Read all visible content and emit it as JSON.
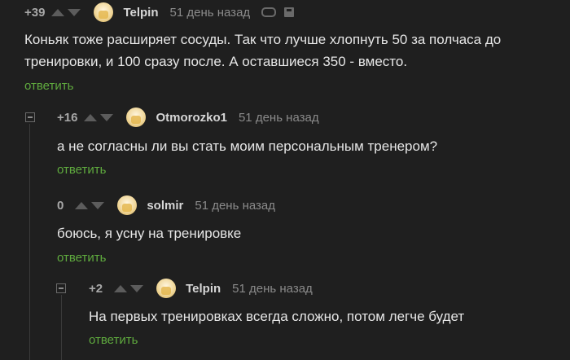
{
  "comments": [
    {
      "rating": "+39",
      "username": "Telpin",
      "time": "51 день назад",
      "text_lines": [
        "Коньяк тоже расширяет сосуды. Так что лучше хлопнуть 50 за полчаса до",
        "тренировки, и 100 сразу после. А оставшиеся 350 - вместо."
      ],
      "reply": "ответить"
    },
    {
      "rating": "+16",
      "username": "Otmorozko1",
      "time": "51 день назад",
      "text_lines": [
        "а не согласны ли вы стать моим персональным тренером?"
      ],
      "reply": "ответить"
    },
    {
      "rating": "0",
      "username": "solmir",
      "time": "51 день назад",
      "text_lines": [
        "боюсь, я усну на тренировке"
      ],
      "reply": "ответить"
    },
    {
      "rating": "+2",
      "username": "Telpin",
      "time": "51 день назад",
      "text_lines": [
        "На первых тренировках всегда сложно, потом легче будет"
      ],
      "reply": "ответить"
    }
  ],
  "icons": {
    "avatar": "avatar-icon",
    "upvote": "arrow-up-icon",
    "downvote": "arrow-down-icon",
    "link": "link-icon",
    "save": "save-icon",
    "collapse": "collapse-icon"
  },
  "colors": {
    "background": "#1f1f1f",
    "reply_link": "#5faa3e",
    "text": "#e6e6e6",
    "meta": "#8a8a8a"
  }
}
